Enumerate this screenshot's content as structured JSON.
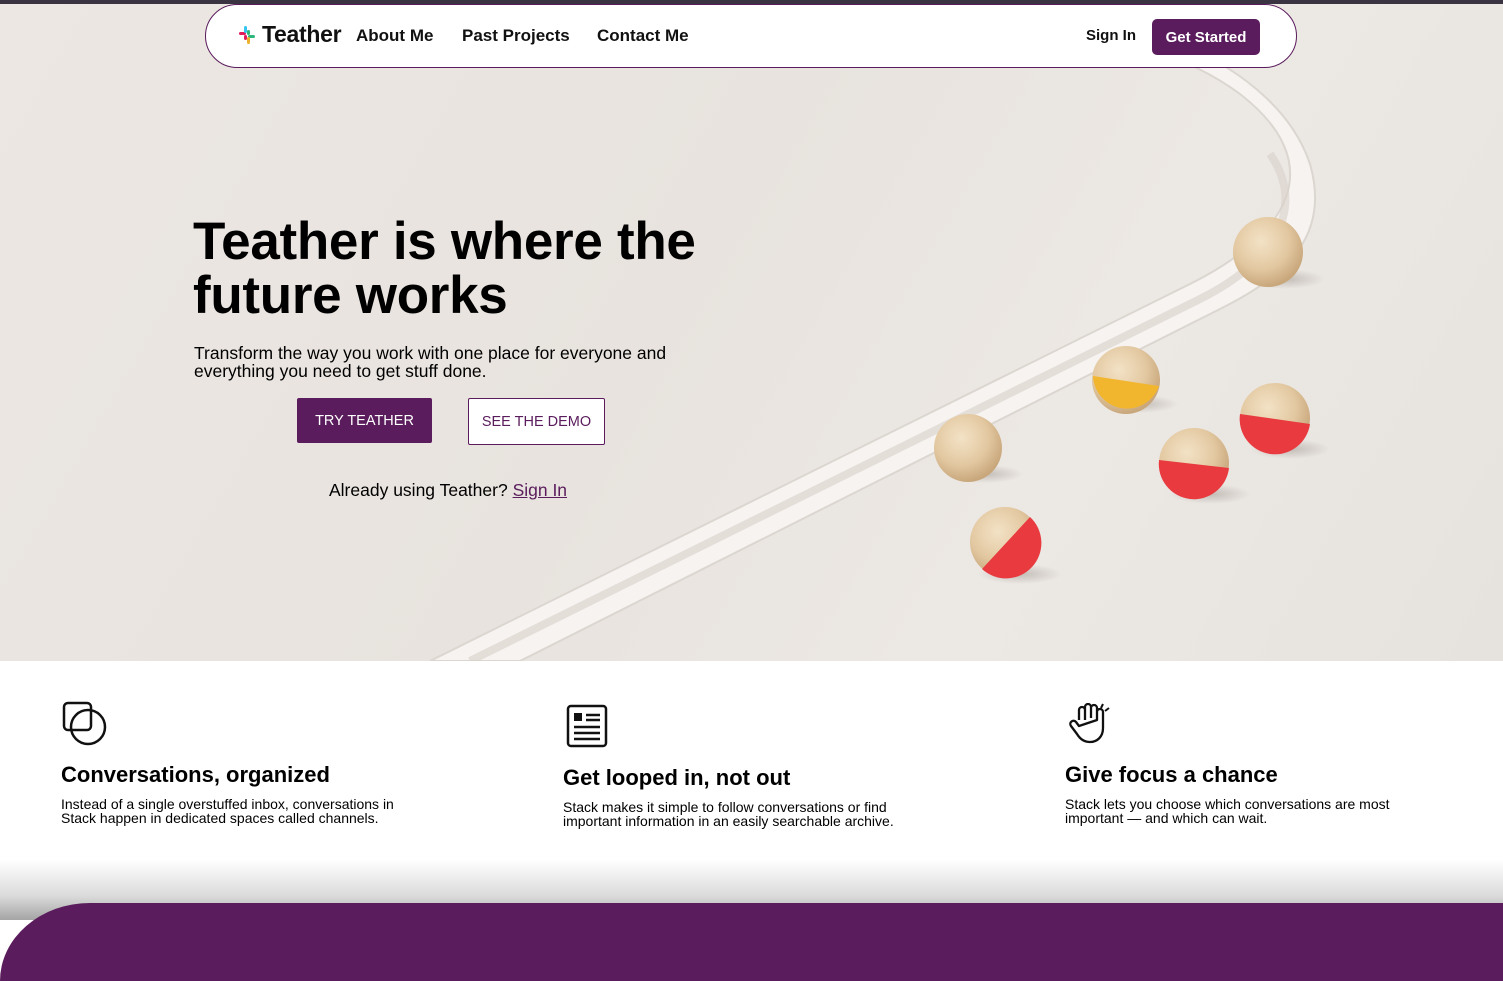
{
  "nav": {
    "logo_text": "Teather",
    "links": [
      "About Me",
      "Past Projects",
      "Contact Me"
    ],
    "sign_in": "Sign In",
    "get_started": "Get Started"
  },
  "hero": {
    "title": "Teather is where the future works",
    "subtitle": "Transform the way you work with one place for everyone and everything you need to get stuff done.",
    "try_button": "TRY TEATHER",
    "demo_button": "SEE THE DEMO",
    "already_text": "Already using Teather?",
    "already_link": "Sign In"
  },
  "features": [
    {
      "icon": "overlapping-shapes-icon",
      "title": "Conversations, organized",
      "text": "Instead of a single overstuffed inbox, conversations in Stack happen in dedicated spaces called channels."
    },
    {
      "icon": "document-list-icon",
      "title": "Get looped in, not out",
      "text": "Stack makes it simple to follow conversations or find important information in an easily searchable archive."
    },
    {
      "icon": "raised-hand-icon",
      "title": "Give focus a chance",
      "text": "Stack lets you choose which conversations are most important — and which can wait."
    }
  ],
  "colors": {
    "brand": "#5a1c5c",
    "hero_bg": "#e8e3de",
    "ball_red": "#e83a3f",
    "ball_yellow": "#f2b62e",
    "wood": "#e6cda8"
  }
}
